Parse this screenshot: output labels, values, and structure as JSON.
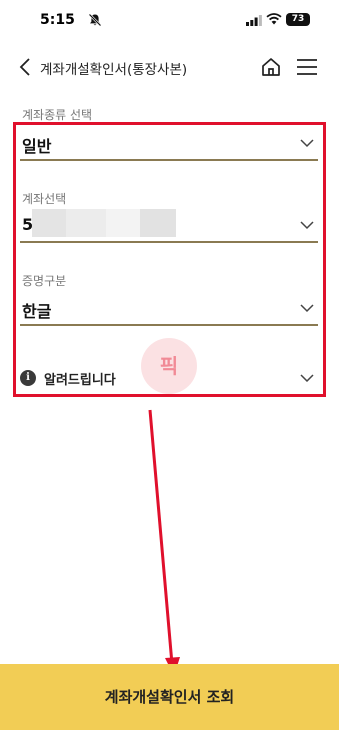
{
  "status_bar": {
    "time": "5:15",
    "battery": "73"
  },
  "header": {
    "title": "계좌개설확인서(통장사본)"
  },
  "form": {
    "account_type": {
      "label": "계좌종류 선택",
      "value": "일반"
    },
    "account_select": {
      "label": "계좌선택",
      "value_visible_prefix": "5"
    },
    "certificate_type": {
      "label": "증명구분",
      "value": "한글"
    },
    "notice": {
      "label": "알려드립니다",
      "icon_glyph": "i"
    }
  },
  "watermark": {
    "text": "픽"
  },
  "submit": {
    "label": "계좌개설확인서 조회"
  },
  "colors": {
    "highlight": "#e0102c",
    "underline": "#8a7a52",
    "button": "#f2cd55"
  }
}
